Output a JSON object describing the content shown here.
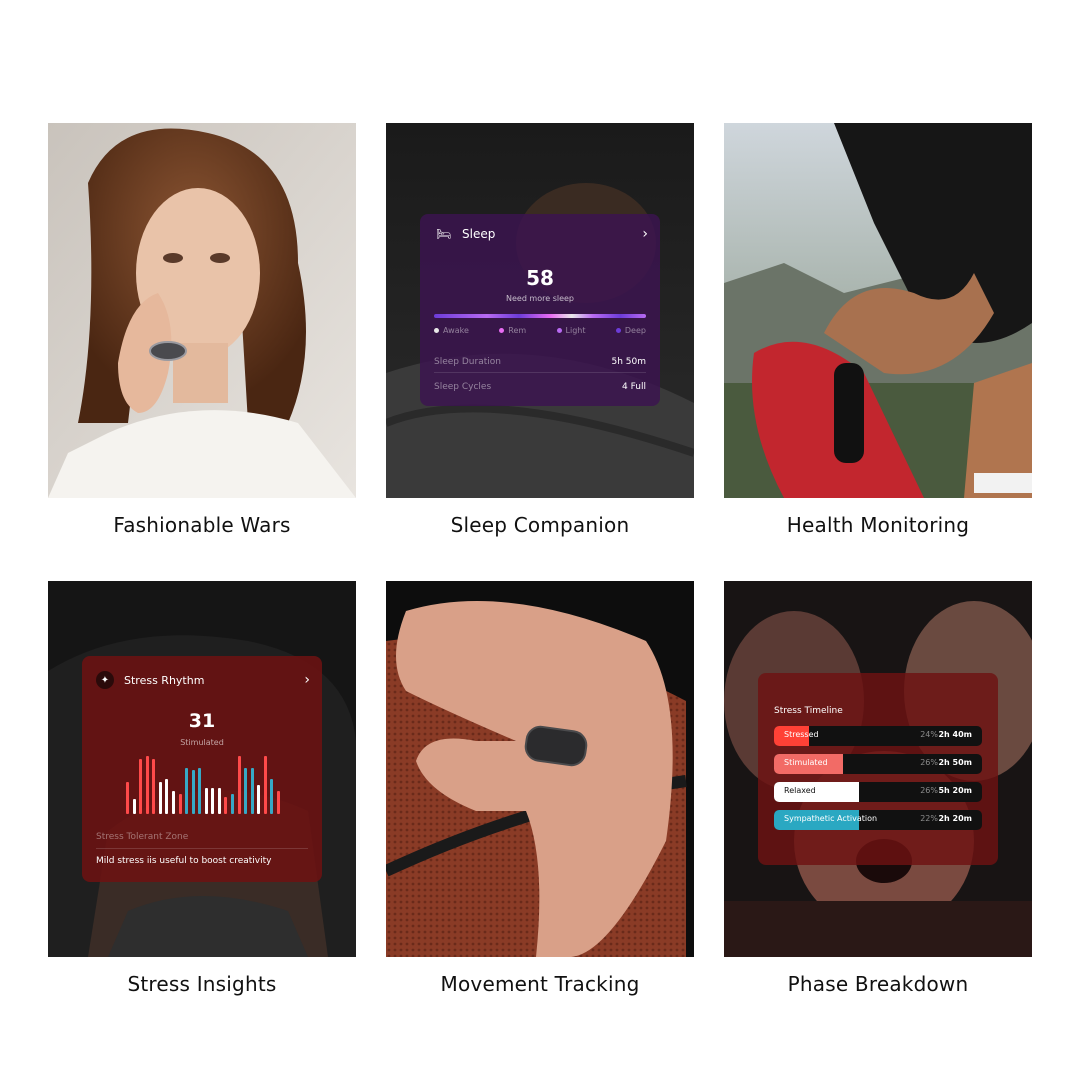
{
  "tiles": [
    {
      "caption": "Fashionable Wars"
    },
    {
      "caption": "Sleep Companion"
    },
    {
      "caption": "Health Monitoring"
    },
    {
      "caption": "Stress Insights"
    },
    {
      "caption": "Movement Tracking"
    },
    {
      "caption": "Phase Breakdown"
    }
  ],
  "sleep_card": {
    "title": "Sleep",
    "score": "58",
    "status": "Need more sleep",
    "legend": [
      {
        "label": "Awake",
        "color": "#e8e8e8"
      },
      {
        "label": "Rem",
        "color": "#e86cf2"
      },
      {
        "label": "Light",
        "color": "#b86af2"
      },
      {
        "label": "Deep",
        "color": "#6c3cd8"
      }
    ],
    "rows": [
      {
        "label": "Sleep Duration",
        "value": "5h 50m"
      },
      {
        "label": "Sleep Cycles",
        "value": "4 Full"
      }
    ]
  },
  "stress_card": {
    "title": "Stress Rhythm",
    "score": "31",
    "status": "Stimulated",
    "zone_label": "Stress Tolerant Zone",
    "tip": "Mild stress iis useful to boost creativity",
    "bars": [
      {
        "level": 0.55,
        "color": "#ff4a4a"
      },
      {
        "level": 0.25,
        "color": "#ffffff"
      },
      {
        "level": 0.95,
        "color": "#ff4a4a"
      },
      {
        "level": 1.0,
        "color": "#ff4a4a"
      },
      {
        "level": 0.95,
        "color": "#ff4a4a"
      },
      {
        "level": 0.55,
        "color": "#ffffff"
      },
      {
        "level": 0.6,
        "color": "#ffffff"
      },
      {
        "level": 0.4,
        "color": "#ffffff"
      },
      {
        "level": 0.35,
        "color": "#ff4a4a"
      },
      {
        "level": 0.8,
        "color": "#36a9c6"
      },
      {
        "level": 0.75,
        "color": "#36a9c6"
      },
      {
        "level": 0.8,
        "color": "#36a9c6"
      },
      {
        "level": 0.45,
        "color": "#ffffff"
      },
      {
        "level": 0.45,
        "color": "#ffffff"
      },
      {
        "level": 0.45,
        "color": "#ffffff"
      },
      {
        "level": 0.3,
        "color": "#ff4a4a"
      },
      {
        "level": 0.35,
        "color": "#36a9c6"
      },
      {
        "level": 1.0,
        "color": "#ff4a4a"
      },
      {
        "level": 0.8,
        "color": "#36a9c6"
      },
      {
        "level": 0.8,
        "color": "#36a9c6"
      },
      {
        "level": 0.5,
        "color": "#ffffff"
      },
      {
        "level": 1.0,
        "color": "#ff4a4a"
      },
      {
        "level": 0.6,
        "color": "#36a9c6"
      },
      {
        "level": 0.4,
        "color": "#ff4a4a"
      }
    ]
  },
  "timeline_card": {
    "title": "Stress Timeline",
    "rows": [
      {
        "label": "Stressed",
        "pct": "24%",
        "time": "2h 40m",
        "color": "#ff4136",
        "text_color": "#ffffff",
        "fraction": 0.17
      },
      {
        "label": "Stimulated",
        "pct": "26%",
        "time": "2h 50m",
        "color": "#f26b66",
        "text_color": "#ffffff",
        "fraction": 0.33
      },
      {
        "label": "Relaxed",
        "pct": "26%",
        "time": "5h 20m",
        "color": "#ffffff",
        "text_color": "#111111",
        "fraction": 0.41
      },
      {
        "label": "Sympathetic Activation",
        "pct": "22%",
        "time": "2h 20m",
        "color": "#2aa8c2",
        "text_color": "#ffffff",
        "fraction": 0.41
      }
    ]
  }
}
